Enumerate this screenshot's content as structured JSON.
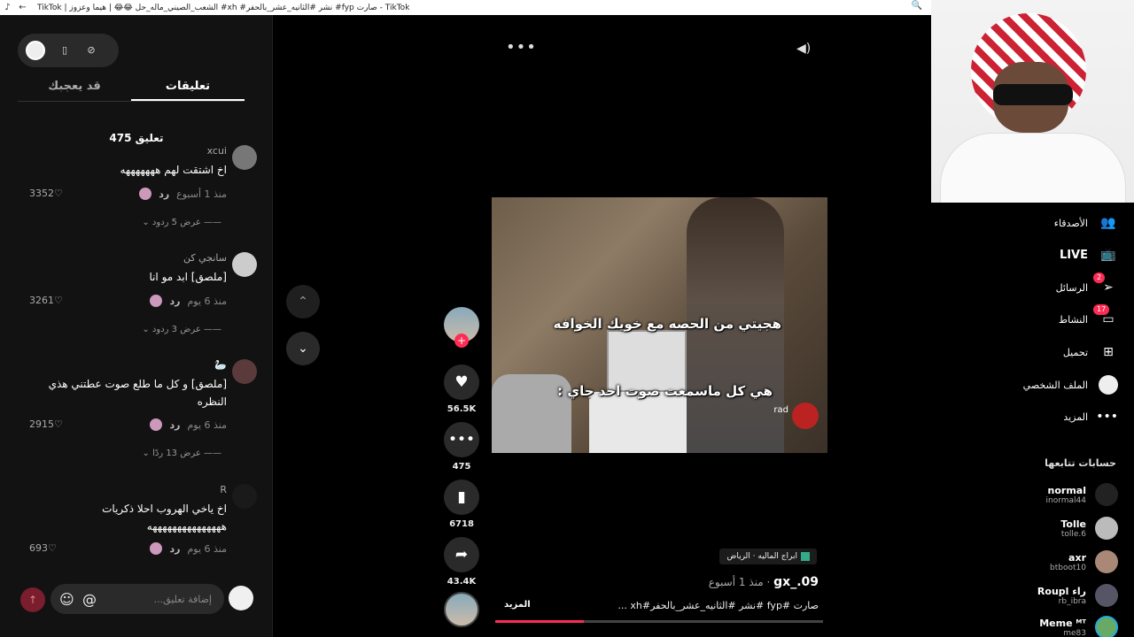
{
  "browser": {
    "title": "TikTok | الشعب_الصيني_ماله_حل 😂😂 | هيما وعزوز #xh #نشر #الثانيه_عشر_بالحفر #fyp صارت - TikTok"
  },
  "left_panel": {
    "tabs": [
      "تعليقات",
      "قد يعجبك"
    ],
    "comment_count": "475 تعليق",
    "reply_label": "رد",
    "comments": [
      {
        "user": "xcui",
        "text": "اخ اشتقت لهم هههههههه",
        "time": "منذ 1 أسبوع",
        "likes": "3352",
        "more": "عرض 5 ردود"
      },
      {
        "user": "سانجي كن",
        "text": "[ملصق] ابد مو انا",
        "time": "منذ 6 يوم",
        "likes": "3261",
        "more": "عرض 3 ردود"
      },
      {
        "user": "🦢",
        "text": "[ملصق] و كل ما طلع صوت عطتني هذي النظره",
        "time": "منذ 6 يوم",
        "likes": "2915",
        "more": "عرض 13 ردًا"
      },
      {
        "user": "R",
        "text": "اخ ياخي الهروب احلا ذكريات هههههههههههههههه",
        "time": "منذ 6 يوم",
        "likes": "693",
        "more": ""
      }
    ],
    "input_placeholder": "إضافة تعليق...",
    "at_symbol": "@"
  },
  "video": {
    "caption_top": "هجيتي من الحصه مع خويك الخوافه",
    "caption_bottom": "هي كل ماسمعت صوت احد جاي :",
    "overlay_name": "rad",
    "likes": "56.5K",
    "comments": "475",
    "saves": "6718",
    "shares": "43.4K",
    "location": "ابراج الماليه · الرياض",
    "author": "gx_.09",
    "posted": " · منذ 1 أسبوع",
    "description": "صارت #fyp #نشر #الثانيه_عشر_بالحفر#xh ...",
    "more": "المزيد",
    "progress": 0.27
  },
  "sidebar": {
    "nav": [
      {
        "label": "الأصدقاء",
        "icon": "friends-icon",
        "badge": ""
      },
      {
        "label": "LIVE",
        "icon": "live-icon",
        "badge": ""
      },
      {
        "label": "الرسائل",
        "icon": "messages-icon",
        "badge": "2"
      },
      {
        "label": "النشاط",
        "icon": "activity-icon",
        "badge": "17"
      },
      {
        "label": "تحميل",
        "icon": "upload-icon",
        "badge": ""
      },
      {
        "label": "الملف الشخصي",
        "icon": "profile-icon",
        "badge": ""
      },
      {
        "label": "المزيد",
        "icon": "more-icon",
        "badge": ""
      }
    ],
    "following_title": "حسابات تتابعها",
    "following": [
      {
        "name": "normal",
        "handle": "inormal44"
      },
      {
        "name": "Tolle",
        "handle": "tolle.6"
      },
      {
        "name": "axr",
        "handle": "btboot10"
      },
      {
        "name": "Roupl راء",
        "handle": "rb_ibra"
      },
      {
        "name": "Meme ᴹᵀ",
        "handle": "me83"
      }
    ]
  },
  "colors": {
    "accent": "#fe2c55",
    "panel": "#121212",
    "bg": "#000000"
  }
}
